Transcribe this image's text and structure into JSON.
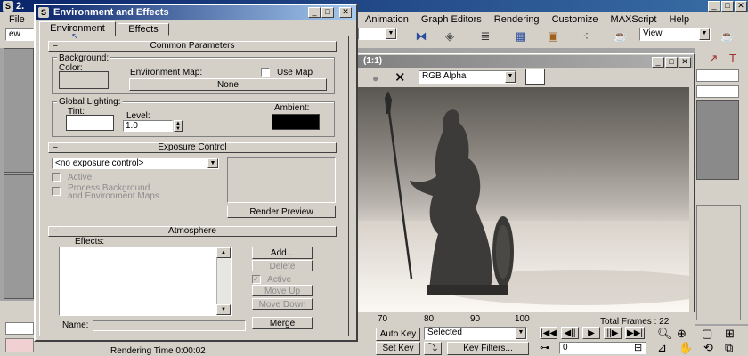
{
  "app": {
    "title_fragment": "2.",
    "menu": [
      "File"
    ],
    "menu_right": [
      "Animation",
      "Graph Editors",
      "Rendering",
      "Customize",
      "MAXScript",
      "Help"
    ],
    "left_combo_value": "ew",
    "view_combo_value": "View"
  },
  "dialog": {
    "title": "Environment and Effects",
    "tabs": [
      "Environment",
      "Effects"
    ],
    "common": {
      "header": "Common Parameters",
      "background_label": "Background:",
      "color_label": "Color:",
      "env_map_label": "Environment Map:",
      "use_map_label": "Use Map",
      "map_button": "None",
      "global_lighting_label": "Global Lighting:",
      "tint_label": "Tint:",
      "level_label": "Level:",
      "level_value": "1.0",
      "ambient_label": "Ambient:"
    },
    "exposure": {
      "header": "Exposure Control",
      "combo_value": "<no exposure control>",
      "active_label": "Active",
      "process_bg_label": "Process Background",
      "process_bg_label2": "and Environment Maps",
      "render_preview": "Render Preview"
    },
    "atmosphere": {
      "header": "Atmosphere",
      "effects_label": "Effects:",
      "buttons": {
        "add": "Add...",
        "delete": "Delete",
        "active": "Active",
        "move_up": "Move Up",
        "move_down": "Move Down",
        "merge": "Merge"
      },
      "name_label": "Name:"
    }
  },
  "render_window": {
    "title": "(1:1)",
    "channel_combo": "RGB Alpha"
  },
  "timeline": {
    "ticks": [
      "70",
      "80",
      "90",
      "100"
    ],
    "total_frames_fragment": "Total Frames : 22"
  },
  "bottom": {
    "status": "Rendering Time  0:00:02",
    "auto_key": "Auto Key",
    "selected_combo": "Selected",
    "set_key": "Set Key",
    "key_filters": "Key Filters...",
    "frame_value": "0"
  },
  "colors": {
    "tint": "#ffffff",
    "ambient": "#000000",
    "color_swatch": "#d4d0c8",
    "titlebar": "#0a246a"
  }
}
